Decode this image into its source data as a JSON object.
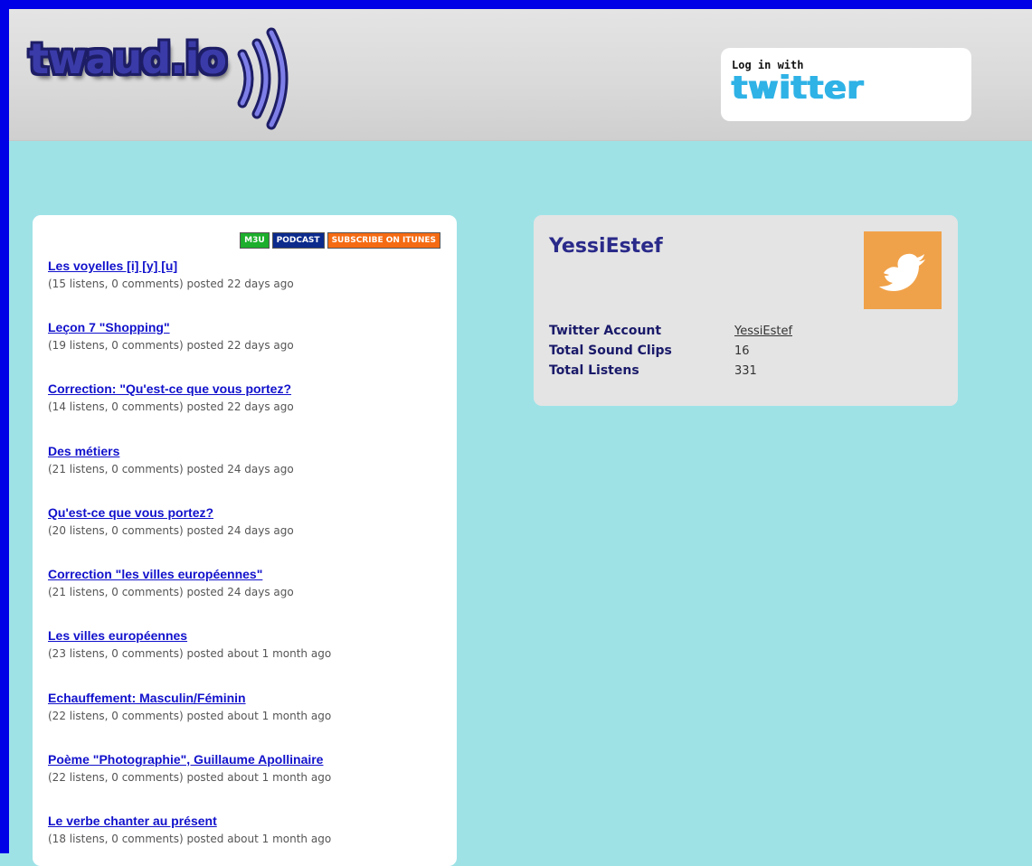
{
  "header": {
    "logo_text": "twaud.io",
    "login": {
      "prefix": "Log in with",
      "service": "twitter"
    }
  },
  "clip_list": {
    "badges": {
      "m3u": "M3U",
      "podcast": "PODCAST",
      "itunes": "SUBSCRIBE ON ITUNES"
    },
    "items": [
      {
        "title": "Les voyelles [i] [y] [u]",
        "meta": "(15 listens, 0 comments) posted 22 days ago"
      },
      {
        "title": "Leçon 7 \"Shopping\"",
        "meta": "(19 listens, 0 comments) posted 22 days ago"
      },
      {
        "title": "Correction: \"Qu'est-ce que vous portez?",
        "meta": "(14 listens, 0 comments) posted 22 days ago"
      },
      {
        "title": "Des métiers",
        "meta": "(21 listens, 0 comments) posted 24 days ago"
      },
      {
        "title": "Qu'est-ce que vous portez?",
        "meta": "(20 listens, 0 comments) posted 24 days ago"
      },
      {
        "title": "Correction \"les villes européennes\"",
        "meta": "(21 listens, 0 comments) posted 24 days ago"
      },
      {
        "title": "Les villes européennes",
        "meta": "(23 listens, 0 comments) posted about 1 month ago"
      },
      {
        "title": "Echauffement: Masculin/Féminin",
        "meta": "(22 listens, 0 comments) posted about 1 month ago"
      },
      {
        "title": "Poème \"Photographie\", Guillaume Apollinaire",
        "meta": "(22 listens, 0 comments) posted about 1 month ago"
      },
      {
        "title": "Le verbe chanter au présent",
        "meta": "(18 listens, 0 comments) posted about 1 month ago"
      }
    ]
  },
  "profile": {
    "name": "YessiEstef",
    "avatar_icon": "twitter-bird-icon",
    "stats": [
      {
        "label": "Twitter Account",
        "value": "YessiEstef"
      },
      {
        "label": "Total Sound Clips",
        "value": "16"
      },
      {
        "label": "Total Listens",
        "value": "331"
      }
    ]
  },
  "colors": {
    "frame": "#0000e6",
    "background": "#9ee2e6",
    "link": "#1111cc",
    "badge_m3u": "#1cae2c",
    "badge_podcast": "#0b2a8c",
    "badge_itunes": "#f56b13",
    "twitter_blue": "#2fb2e6",
    "avatar": "#f0a24a"
  }
}
